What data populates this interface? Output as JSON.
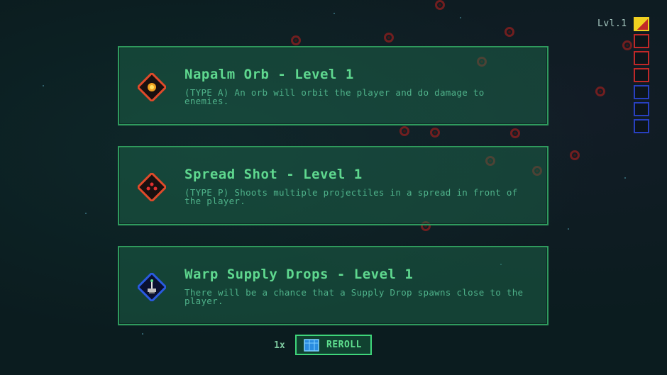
{
  "level_indicator": {
    "label": "Lvl.1"
  },
  "cards": [
    {
      "title": "Napalm Orb - Level 1",
      "description": "(TYPE A) An orb will orbit the player and do damage to enemies.",
      "icon": "napalm-orb-icon",
      "accent": "#e04a2a"
    },
    {
      "title": "Spread Shot - Level 1",
      "description": "(TYPE P) Shoots multiple projectiles in a spread in front of the player.",
      "icon": "spread-shot-icon",
      "accent": "#e04a2a"
    },
    {
      "title": "Warp Supply Drops - Level 1",
      "description": "There will be a chance that a Supply Drop spawns close to the player.",
      "icon": "supply-drop-icon",
      "accent": "#2a5ae0"
    }
  ],
  "slots": {
    "colors": [
      "#f0d020",
      "#c02828",
      "#c02828",
      "#c02828",
      "#2840c0",
      "#2840c0",
      "#2840c0"
    ]
  },
  "reroll": {
    "count": "1x",
    "label": "REROLL",
    "icon": "dice-cube-icon"
  }
}
